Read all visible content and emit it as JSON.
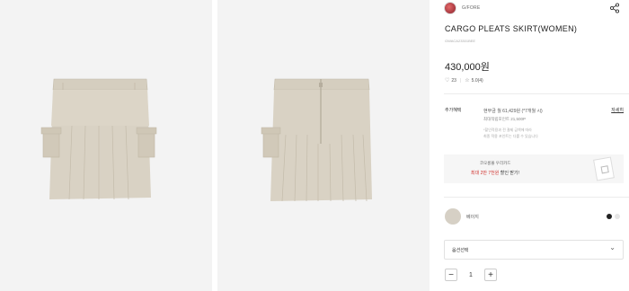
{
  "brand": {
    "name": "G/FORE"
  },
  "product": {
    "title": "CARGO PLEATS SKIRT(WOMEN)",
    "code": "GWACA23301BEE",
    "price": "430,000원",
    "likes": "23",
    "rating": "5.0",
    "rating_count": "(4)"
  },
  "benefit": {
    "label": "추가혜택",
    "detail_link": "자세히",
    "installment": "현부금 월 61,429원 (*7개월 시)",
    "points": "최대적립포인트 21,500P",
    "note1": "*할인적용과 전 결제 금액에 따라",
    "note2": "최종 적용 포인트는 다를 수 있습니다"
  },
  "card_banner": {
    "line1": "코오롱몰 우리카드",
    "line2_red": "최대 2만 7천원",
    "line2_rest": " 할인 받기!"
  },
  "color": {
    "name": "베이지",
    "swatch": "#d6d0c5",
    "options": [
      "#222222",
      "#e6e6e6"
    ]
  },
  "option_select": {
    "label": "옵션선택"
  },
  "quantity": {
    "minus": "−",
    "value": "1",
    "plus": "+"
  },
  "colors": {
    "photo_bg": "#f3f3f3",
    "fabric": "#d8d1c3",
    "accent_red": "#d0302c"
  }
}
